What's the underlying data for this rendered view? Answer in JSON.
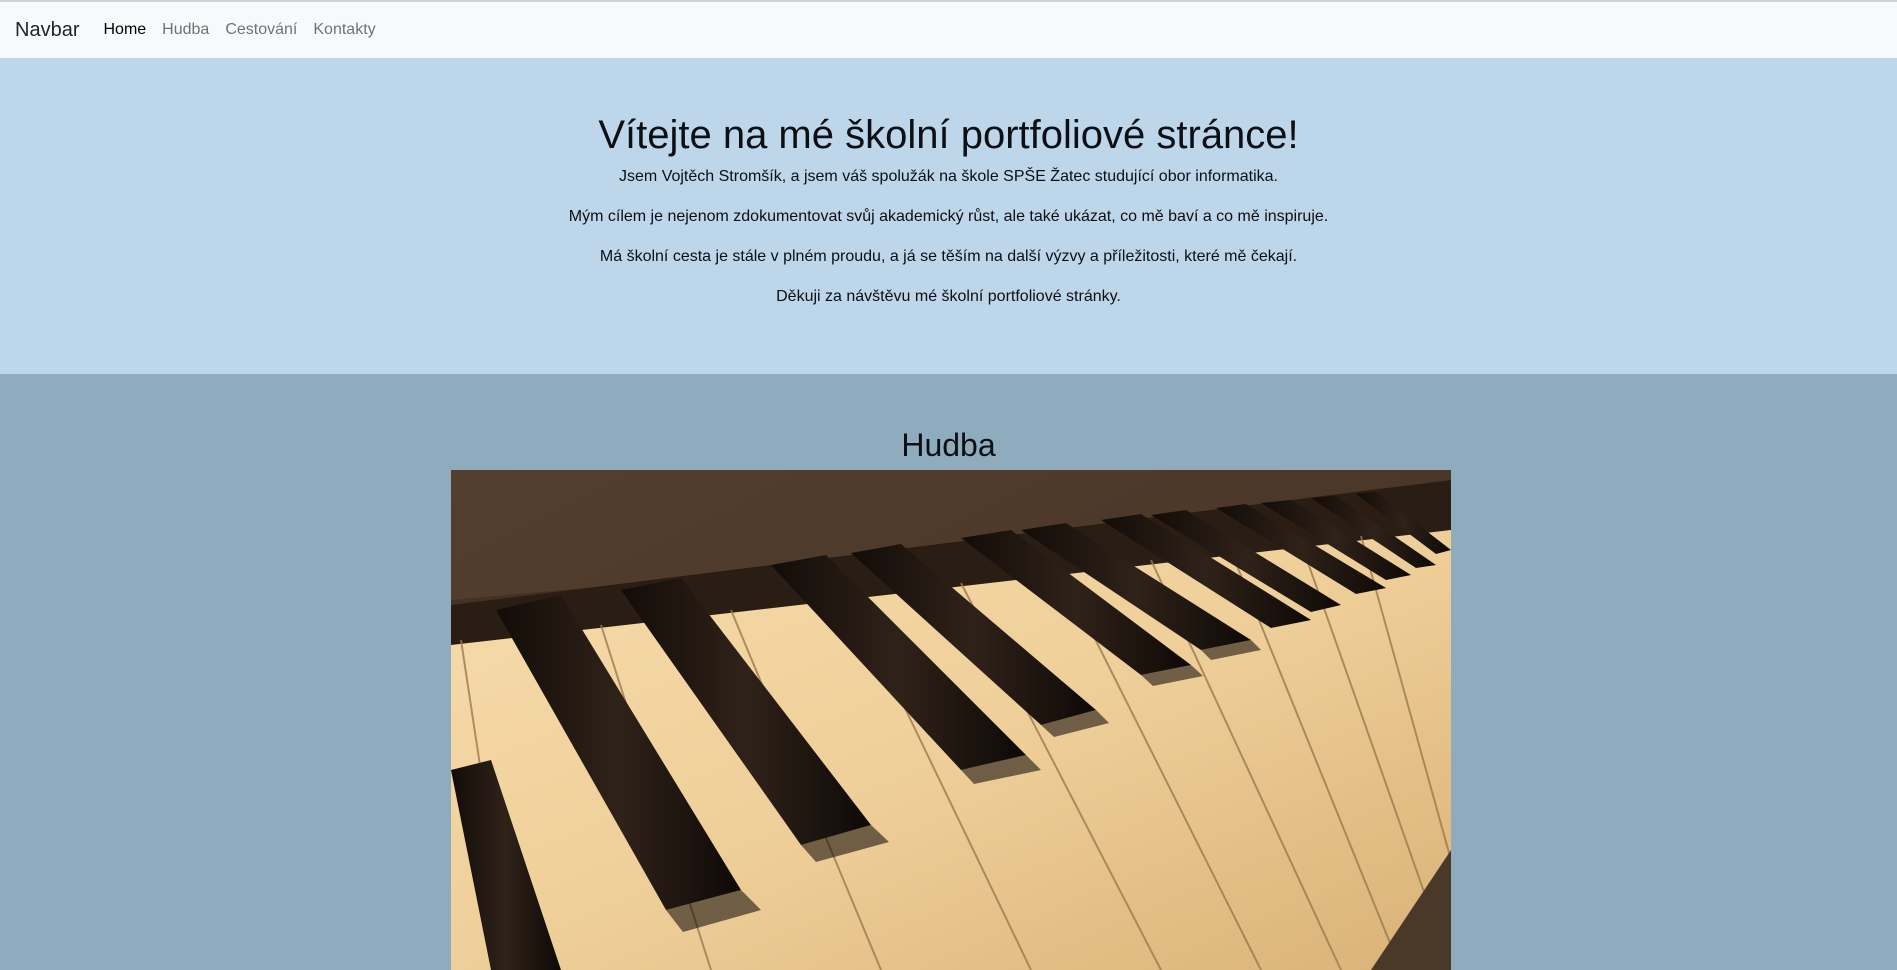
{
  "navbar": {
    "brand": "Navbar",
    "links": [
      {
        "label": "Home",
        "active": true
      },
      {
        "label": "Hudba",
        "active": false
      },
      {
        "label": "Cestování",
        "active": false
      },
      {
        "label": "Kontakty",
        "active": false
      }
    ]
  },
  "hero": {
    "title": "Vítejte na mé školní portfoliové stránce!",
    "paragraphs": [
      "Jsem Vojtěch Stromšík, a jsem váš spolužák na škole SPŠE Žatec studující obor informatika.",
      "Mým cílem je nejenom zdokumentovat svůj akademický růst, ale také ukázat, co mě baví a co mě inspiruje.",
      "Má školní cesta je stále v plném proudu, a já se těším na další výzvy a příležitosti, které mě čekají.",
      "Děkuji za návštěvu mé školní portfoliové stránky."
    ]
  },
  "music": {
    "heading": "Hudba",
    "image_icon": "piano-keys-photo"
  },
  "colors": {
    "navbar_bg": "#f8f9fa",
    "hero_bg": "#bed6ea",
    "music_bg": "#8facbe"
  }
}
